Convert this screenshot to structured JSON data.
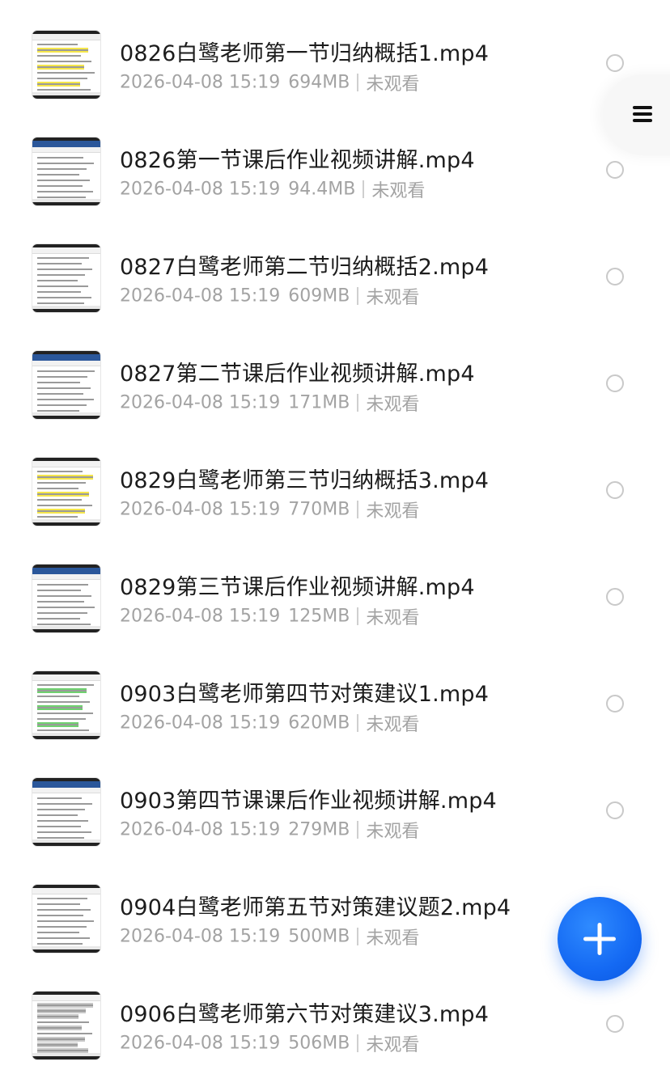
{
  "files": [
    {
      "title": "0826白鹭老师第一节归纳概括1.mp4",
      "date": "2026-04-08 15:19",
      "size": "694MB",
      "status": "未观看",
      "thumb_style": "yellow"
    },
    {
      "title": "0826第一节课后作业视频讲解.mp4",
      "date": "2026-04-08 15:19",
      "size": "94.4MB",
      "status": "未观看",
      "thumb_style": "word"
    },
    {
      "title": "0827白鹭老师第二节归纳概括2.mp4",
      "date": "2026-04-08 15:19",
      "size": "609MB",
      "status": "未观看",
      "thumb_style": "plain"
    },
    {
      "title": "0827第二节课后作业视频讲解.mp4",
      "date": "2026-04-08 15:19",
      "size": "171MB",
      "status": "未观看",
      "thumb_style": "word"
    },
    {
      "title": "0829白鹭老师第三节归纳概括3.mp4",
      "date": "2026-04-08 15:19",
      "size": "770MB",
      "status": "未观看",
      "thumb_style": "yellow"
    },
    {
      "title": "0829第三节课后作业视频讲解.mp4",
      "date": "2026-04-08 15:19",
      "size": "125MB",
      "status": "未观看",
      "thumb_style": "word"
    },
    {
      "title": "0903白鹭老师第四节对策建议1.mp4",
      "date": "2026-04-08 15:19",
      "size": "620MB",
      "status": "未观看",
      "thumb_style": "green"
    },
    {
      "title": "0903第四节课课后作业视频讲解.mp4",
      "date": "2026-04-08 15:19",
      "size": "279MB",
      "status": "未观看",
      "thumb_style": "word"
    },
    {
      "title": "0904白鹭老师第五节对策建议题2.mp4",
      "date": "2026-04-08 15:19",
      "size": "500MB",
      "status": "未观看",
      "thumb_style": "plain"
    },
    {
      "title": "0906白鹭老师第六节对策建议3.mp4",
      "date": "2026-04-08 15:19",
      "size": "506MB",
      "status": "未观看",
      "thumb_style": "gray"
    }
  ],
  "icons": {
    "menu": "hamburger-menu-icon",
    "fab": "plus-icon",
    "radio": "radio-unchecked-icon"
  },
  "colors": {
    "accent": "#1469f3",
    "title_text": "#1c1c1c",
    "meta_text": "#a3a3a3",
    "radio_border": "#c9c9c9"
  }
}
